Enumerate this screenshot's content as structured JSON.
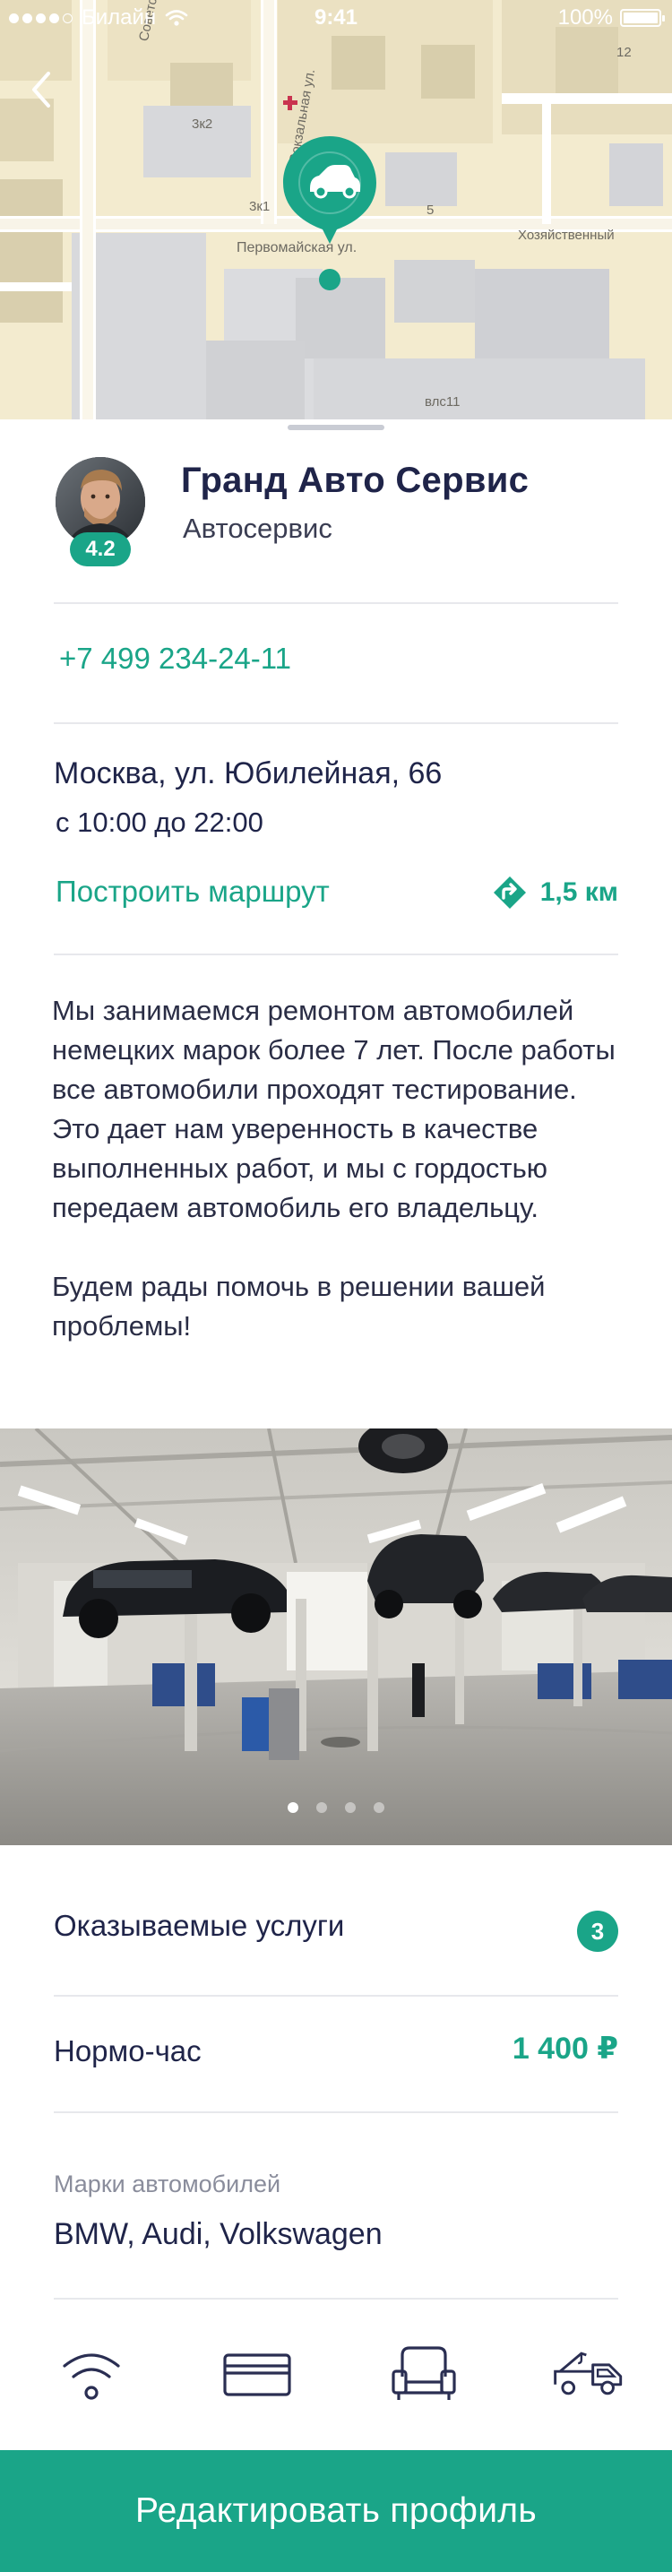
{
  "status_bar": {
    "carrier": "Билайн",
    "time": "9:41",
    "battery": "100%"
  },
  "map": {
    "streets": [
      "Советская",
      "Первомайская ул.",
      "Вокзальная ул.",
      "Хозяйственный",
      "влс11",
      "3к2",
      "3к1",
      "5",
      "12"
    ],
    "pin_icon": "car-icon"
  },
  "business": {
    "name": "Гранд Авто Сервис",
    "category": "Автосервис",
    "rating": "4.2",
    "phone": "+7 499 234-24-11",
    "address": "Москва, ул. Юбилейная, 66",
    "hours": "с 10:00 до 22:00",
    "route_label": "Построить маршрут",
    "distance": "1,5 км",
    "description": [
      "Мы занимаемся ремонтом автомобилей немецких марок более 7 лет. После работы все автомобили проходят тестирование. Это дает нам уверенность в качестве выполненных работ, и мы с гордостью передаем автомобиль его владельцу.",
      "Будем рады помочь в решении вашей проблемы!"
    ]
  },
  "gallery": {
    "count": 4,
    "active_index": 0
  },
  "details": {
    "services_label": "Оказываемые услуги",
    "services_count": "3",
    "hourly_label": "Нормо-час",
    "hourly_price": "1 400 ₽",
    "brands_caption": "Марки автомобилей",
    "brands_value": "BMW, Audi, Volkswagen"
  },
  "amenities": [
    "wifi-icon",
    "card-payment-icon",
    "lounge-chair-icon",
    "tow-truck-icon"
  ],
  "colors": {
    "accent": "#1aa588",
    "title": "#1f2449",
    "divider": "#e7e8ec"
  },
  "cta": {
    "label": "Редактировать профиль"
  }
}
